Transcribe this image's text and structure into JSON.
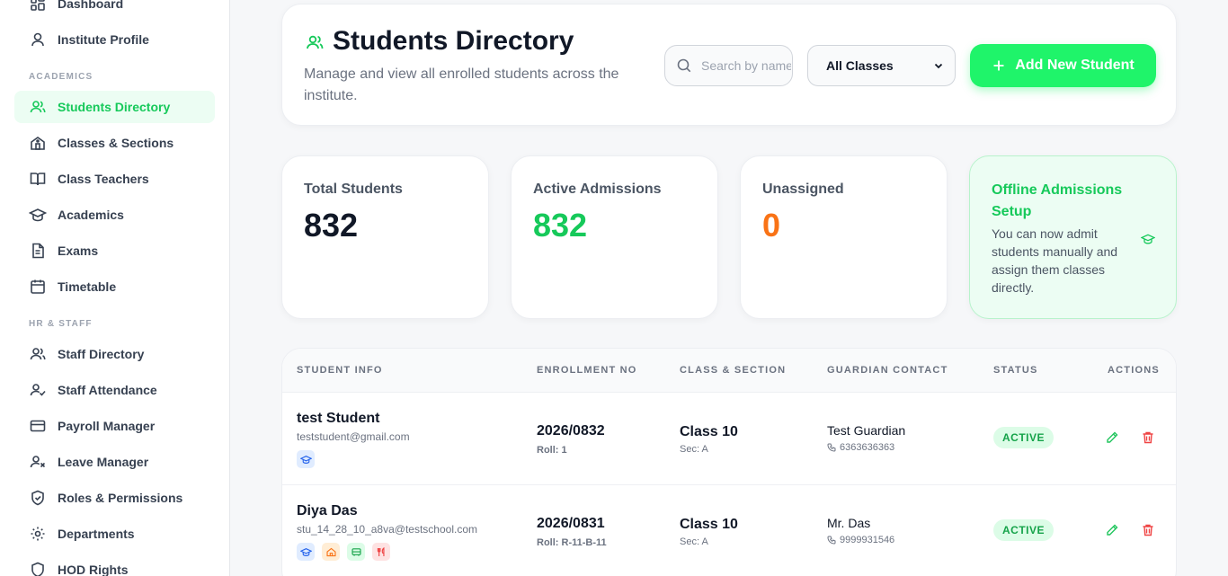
{
  "sidebar": {
    "items_top": [
      {
        "label": "Dashboard",
        "icon": "dashboard-icon"
      },
      {
        "label": "Institute Profile",
        "icon": "user-icon"
      }
    ],
    "section_academics": "ACADEMICS",
    "items_academics": [
      {
        "label": "Students Directory",
        "icon": "users-icon",
        "active": true
      },
      {
        "label": "Classes & Sections",
        "icon": "school-icon"
      },
      {
        "label": "Class Teachers",
        "icon": "book-icon"
      },
      {
        "label": "Academics",
        "icon": "graduation-cap-icon"
      },
      {
        "label": "Exams",
        "icon": "document-icon"
      },
      {
        "label": "Timetable",
        "icon": "calendar-icon"
      }
    ],
    "section_hr": "HR & STAFF",
    "items_hr": [
      {
        "label": "Staff Directory",
        "icon": "users-icon"
      },
      {
        "label": "Staff Attendance",
        "icon": "user-check-icon"
      },
      {
        "label": "Payroll Manager",
        "icon": "credit-card-icon"
      },
      {
        "label": "Leave Manager",
        "icon": "user-x-icon"
      },
      {
        "label": "Roles & Permissions",
        "icon": "shield-check-icon"
      },
      {
        "label": "Departments",
        "icon": "settings-icon"
      },
      {
        "label": "HOD Rights",
        "icon": "shield-icon"
      }
    ]
  },
  "header": {
    "title": "Students Directory",
    "subtitle": "Manage and view all enrolled students across the institute.",
    "search_placeholder": "Search by name",
    "class_filter": "All Classes",
    "add_button": "Add New Student"
  },
  "stats": {
    "total_label": "Total Students",
    "total_value": "832",
    "active_label": "Active Admissions",
    "active_value": "832",
    "unassigned_label": "Unassigned",
    "unassigned_value": "0",
    "offline_title": "Offline Admissions Setup",
    "offline_text": "You can now admit students manually and assign them classes directly."
  },
  "table": {
    "headers": [
      "STUDENT INFO",
      "ENROLLMENT NO",
      "CLASS & SECTION",
      "GUARDIAN CONTACT",
      "STATUS",
      "ACTIONS"
    ],
    "rows": [
      {
        "name": "test Student",
        "email": "teststudent@gmail.com",
        "enrollment": "2026/0832",
        "roll": "Roll: 1",
        "class": "Class 10",
        "section": "Sec: A",
        "guardian": "Test Guardian",
        "phone": "6363636363",
        "status": "ACTIVE"
      },
      {
        "name": "Diya Das",
        "email": "stu_14_28_10_a8va@testschool.com",
        "enrollment": "2026/0831",
        "roll": "Roll: R-11-B-11",
        "class": "Class 10",
        "section": "Sec: A",
        "guardian": "Mr. Das",
        "phone": "9999931546",
        "status": "ACTIVE"
      }
    ]
  },
  "colors": {
    "accent": "#1ff46a",
    "accent_text": "#16c95a",
    "active_value": "#16c95a",
    "unassigned_value": "#f97316"
  }
}
